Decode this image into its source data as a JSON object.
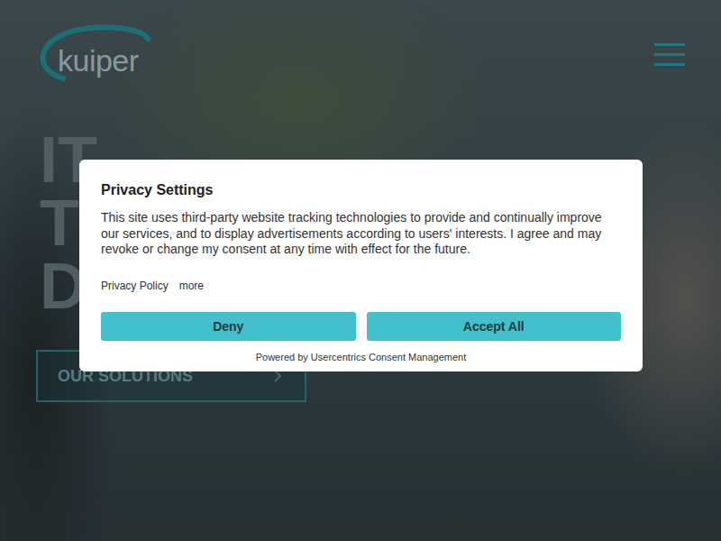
{
  "header": {
    "logo": "kuiper"
  },
  "hero": {
    "lines": [
      "IT",
      "T",
      "D"
    ],
    "button": {
      "label": "OUR SOLUTIONS"
    }
  },
  "consent": {
    "title": "Privacy Settings",
    "text": "This site uses third-party website tracking technologies to provide and continually improve our services, and to display advertisements according to users' interests. I agree and may revoke or change my consent at any time with effect for the future.",
    "links": [
      "Privacy Policy",
      "more"
    ],
    "buttons": [
      "Deny",
      "Accept All"
    ],
    "footer": "Powered by Usercentrics Consent Management"
  }
}
